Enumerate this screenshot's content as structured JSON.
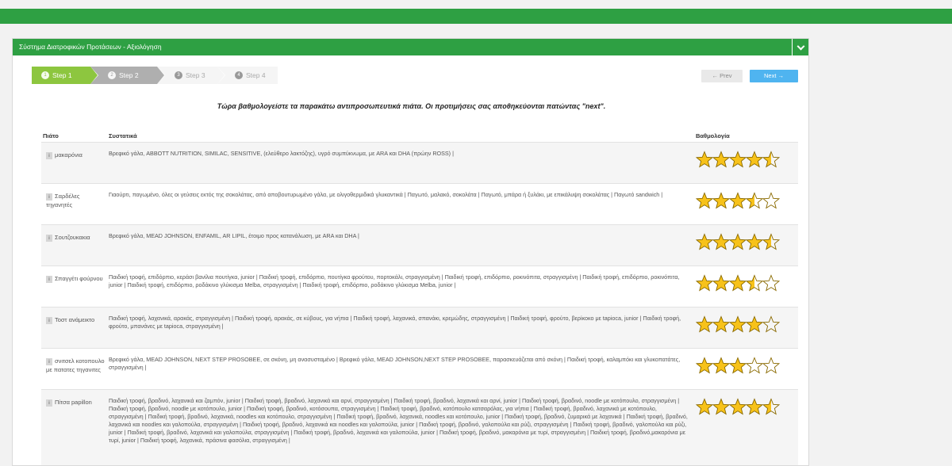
{
  "panel": {
    "title": "Σύστημα Διατροφικών Προτάσεων - Αξιολόγηση"
  },
  "wizard": {
    "steps": [
      {
        "num": "1",
        "label": "Step 1"
      },
      {
        "num": "2",
        "label": "Step 2"
      },
      {
        "num": "3",
        "label": "Step 3"
      },
      {
        "num": "4",
        "label": "Step 4"
      }
    ]
  },
  "nav": {
    "prev_label": "← Prev",
    "next_label": "Next →"
  },
  "instruction": "Τώρα βαθμολογείστε τα παρακάτω αντιπροσωπευτικά πιάτα. Οι προτιμήσεις σας αποθηκεύονται πατώντας \"next\".",
  "table": {
    "headers": {
      "dish": "Πιάτο",
      "ingredients": "Συστατικά",
      "rating": "Βαθμολογία"
    },
    "rows": [
      {
        "dish": "μακαρόνια",
        "rating": 4.5,
        "ingredients": "Βρεφικό γάλα, ABBOTT NUTRITION, SIMILAC, SENSITIVE, (ελεύθερο λακτόζης), υγρό συμπύκνωμα, με ARA και DHA (πρώην ROSS) |"
      },
      {
        "dish": "Σαρδέλες τηγανητές",
        "rating": 3.5,
        "ingredients": "Γιαούρτι, παγωμένο, όλες οι γεύσεις εκτός της σοκολάτας, από αποβουτυρωμένο γάλα, με ολιγοθερμιδικά γλυκαντικά | Παγωτό, μαλακό, σοκολάτα | Παγωτό, μπάρα ή ξυλάκι, με επικάλυψη σοκολάτας | Παγωτό sandwich |"
      },
      {
        "dish": "Σουτζουκακια",
        "rating": 4.5,
        "ingredients": "Βρεφικό γάλα, MEAD JOHNSON, ENFAMIL, AR LIPIL, έτοιμο προς κατανάλωση, με ARA και DHA |"
      },
      {
        "dish": "Σπαγγέτι φούρνου",
        "rating": 3.5,
        "ingredients": "Παιδική τροφή, επιδόρπιο, κεράσι βανίλια πουτίγκα, junior | Παιδική τροφή, επιδόρπιο, πουτίγκα φρούτου, πορτοκάλι, στραγγισμένη | Παιδική τροφή, επιδόρπιο, ροκινόπιτα, στραγγισμένη | Παιδική τροφή, επιδόρπιο, ροκινόπιτα, junior | Παιδική τροφή, επιδόρπιο, ροδάκινο γλύκισμα Melba, στραγγισμένη | Παιδική τροφή, επιδόρπιο, ροδάκινο γλύκισμα Melba, junior |"
      },
      {
        "dish": "Τοστ ανάμεικτο",
        "rating": 4,
        "ingredients": "Παιδική τροφή, λαχανικά, αρακάς, στραγγισμένη | Παιδική τροφή, αρακάς, σε κύβους, για νήπια | Παιδική τροφή, λαχανικά, σπανάκι, κρεμώδης, στραγγισμένη | Παιδική τροφή, φρούτο, βερίκοκο με tapioca, junior | Παιδική τροφή, φρούτο, μπανάνες με tapioca, στραγγισμένη |"
      },
      {
        "dish": "σνιτσελ κοτοπουλο με πατατες τηγανιτες",
        "rating": 3,
        "ingredients": "Βρεφικό γάλα, MEAD JOHNSON, NEXT STEP PROSOBEE, σε σκόνη, μη ανασυσταμένο | Βρεφικό γάλα, MEAD JOHNSON,NEXT STEP PROSOBEE, παρασκευάζεται από σκόνη | Παιδική τροφή, καλαμπόκι και γλυκοπατάτες, στραγγισμένη |"
      },
      {
        "dish": "Πίτσα papillon",
        "rating": 4.5,
        "ingredients": "Παιδική τροφή, βραδινό, λαχανικά και ζαμπόν, junior | Παιδική τροφή, βραδινό, λαχανικά και αρνί, στραγγισμένη | Παιδική τροφή, βραδινό, λαχανικά και αρνί, junior | Παιδική τροφή, βραδινό, noodle με κοτόπουλο, στραγγισμένη | Παιδική τροφή, βραδινό, noodle με κοτόπουλο, junior | Παιδική τροφή, βραδινό, κοτόσουπα, στραγγισμένη | Παιδική τροφή, βραδινό, κοτόπουλο κατσαρόλας, για νήπια | Παιδική τροφή, βραδινό, λαχανικά με κοτόπουλο, στραγγισμένη | Παιδική τροφή, βραδινό, λαχανικά, noodles και κοτόπουλο, στραγγισμένη | Παιδική τροφή, βραδινό, λαχανικά, noodles και κοτόπουλο, junior | Παιδική τροφή, βραδινό, ζυμαρικά με λαχανικά | Παιδική τροφή, βραδινό, λαχανικά και noodles και γαλοπούλα, στραγγισμένη | Παιδική τροφή, βραδινό, λαχανικά και noodles και γαλοπούλα, junior | Παιδική τροφή, βραδινό, γαλοπούλα και ρύζι, στραγγισμένη | Παιδική τροφή, βραδινό, γαλοπούλα και ρύζι, junior | Παιδική τροφή, βραδινό, λαχανικά και γαλοπούλα, στραγγισμένη | Παιδική τροφή, βραδινό, λαχανικά και γαλοπούλα, junior | Παιδική τροφή, βραδινό, μακαρόνια με τυρί, στραγγισμένη | Παιδική τροφή, βραδινό,μακαρόνια με τυρί, junior | Παιδική τροφή, λαχανικά, πράσινα φασόλια, στραγγισμένη |"
      }
    ]
  },
  "colors": {
    "green": "#2ea043",
    "step_active": "#8dc63f",
    "next_blue": "#4fb4f0",
    "star_fill": "#f7c21a",
    "star_stroke": "#8a6a00"
  },
  "icons": {
    "info": "i",
    "collapse": "chevron-down-icon",
    "step": "circle-number-icon"
  }
}
